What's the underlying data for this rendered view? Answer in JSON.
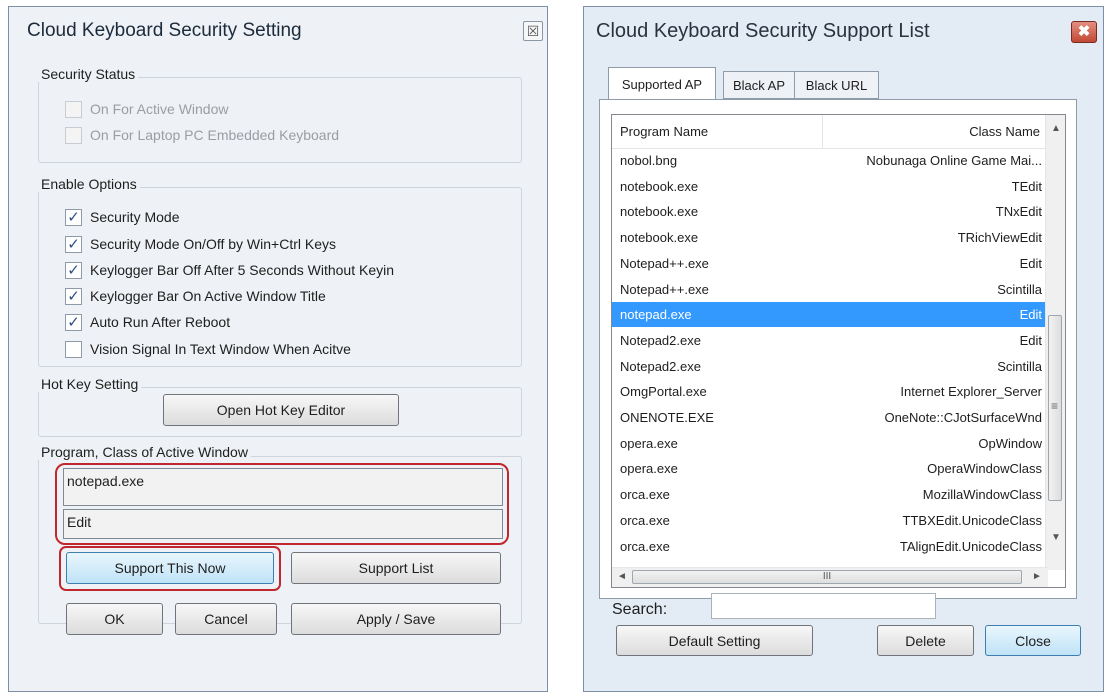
{
  "settings_dialog": {
    "title": "Cloud Keyboard Security Setting",
    "close_glyph": "☒",
    "security_status": {
      "label": "Security Status",
      "items": [
        {
          "label": "On For Active Window",
          "checked": false,
          "disabled": true
        },
        {
          "label": "On For Laptop PC Embedded Keyboard",
          "checked": false,
          "disabled": true
        }
      ]
    },
    "enable_options": {
      "label": "Enable Options",
      "items": [
        {
          "label": "Security Mode",
          "checked": true
        },
        {
          "label": "Security Mode On/Off by Win+Ctrl Keys",
          "checked": true
        },
        {
          "label": "Keylogger Bar Off After 5 Seconds Without Keyin",
          "checked": true
        },
        {
          "label": "Keylogger Bar On Active Window Title",
          "checked": true
        },
        {
          "label": "Auto Run After Reboot",
          "checked": true
        },
        {
          "label": "Vision Signal In Text Window When Acitve",
          "checked": false
        }
      ]
    },
    "hot_key": {
      "label": "Hot Key Setting",
      "button": "Open Hot Key Editor"
    },
    "active_window": {
      "label": "Program, Class of Active Window",
      "program_value": "notepad.exe",
      "class_value": "Edit",
      "support_now_button": "Support This Now",
      "support_list_button": "Support List"
    },
    "ok_button": "OK",
    "cancel_button": "Cancel",
    "apply_button": "Apply / Save",
    "check_glyph": "✓",
    "highlight_color": "#c0282d"
  },
  "support_list_dialog": {
    "title": "Cloud Keyboard Security Support List",
    "close_glyph": "✖",
    "tabs": [
      "Supported AP",
      "Black AP",
      "Black URL"
    ],
    "active_tab": "Supported AP",
    "columns": [
      "Program Name",
      "Class Name"
    ],
    "rows": [
      {
        "program": "nobol.bng",
        "class": "Nobunaga Online Game Mai..."
      },
      {
        "program": "notebook.exe",
        "class": "TEdit"
      },
      {
        "program": "notebook.exe",
        "class": "TNxEdit"
      },
      {
        "program": "notebook.exe",
        "class": "TRichViewEdit"
      },
      {
        "program": "Notepad++.exe",
        "class": "Edit"
      },
      {
        "program": "Notepad++.exe",
        "class": "Scintilla"
      },
      {
        "program": "notepad.exe",
        "class": "Edit",
        "selected": true
      },
      {
        "program": "Notepad2.exe",
        "class": "Edit"
      },
      {
        "program": "Notepad2.exe",
        "class": "Scintilla"
      },
      {
        "program": "OmgPortal.exe",
        "class": "Internet Explorer_Server"
      },
      {
        "program": "ONENOTE.EXE",
        "class": "OneNote::CJotSurfaceWnd"
      },
      {
        "program": "opera.exe",
        "class": "OpWindow"
      },
      {
        "program": "opera.exe",
        "class": "OperaWindowClass"
      },
      {
        "program": "orca.exe",
        "class": "MozillaWindowClass"
      },
      {
        "program": "orca.exe",
        "class": "TTBXEdit.UnicodeClass"
      },
      {
        "program": "orca.exe",
        "class": "TAlignEdit.UnicodeClass"
      }
    ],
    "scroll": {
      "up": "▲",
      "down": "▼",
      "left": "◄",
      "right": "►",
      "grip": "III",
      "vgrip": "≡"
    },
    "search_label": "Search:",
    "search_value": "",
    "default_button": "Default Setting",
    "delete_button": "Delete",
    "close_button": "Close",
    "selection_color": "#3399ff"
  }
}
